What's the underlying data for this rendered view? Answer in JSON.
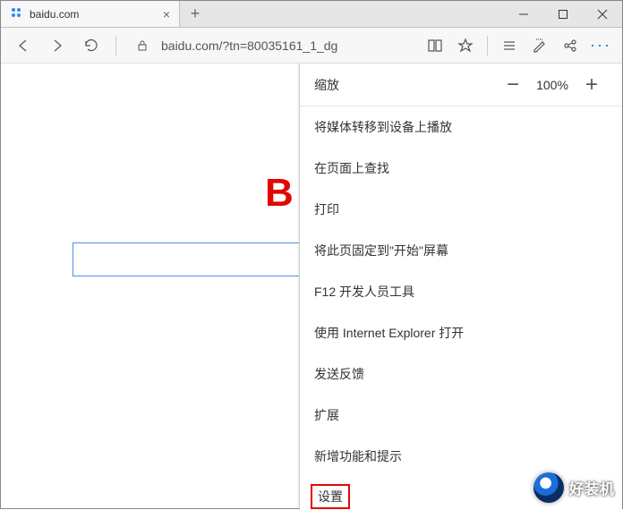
{
  "tab": {
    "title": "baidu.com"
  },
  "url": "baidu.com/?tn=80035161_1_dg",
  "page": {
    "logo_fragment": "B"
  },
  "menu": {
    "zoom_label": "缩放",
    "zoom_value": "100%",
    "items": [
      "将媒体转移到设备上播放",
      "在页面上查找",
      "打印",
      "将此页固定到\"开始\"屏幕",
      "F12 开发人员工具",
      "使用 Internet Explorer 打开",
      "发送反馈",
      "扩展",
      "新增功能和提示"
    ],
    "highlighted": "设置"
  },
  "watermark": "好装机"
}
